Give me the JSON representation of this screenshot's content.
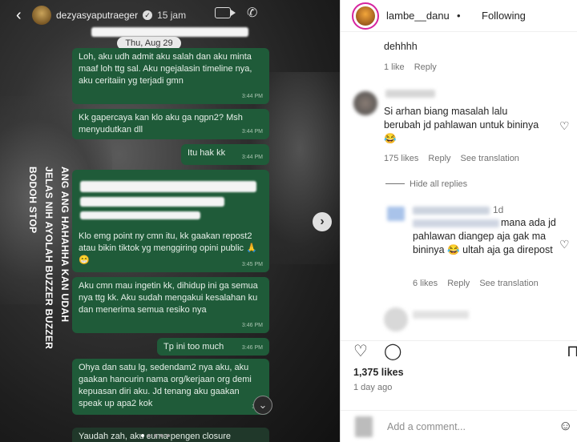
{
  "story": {
    "username": "dezyasyaputraeger",
    "time": "15 jam",
    "date": "Thu, Aug 29",
    "overlay_lines": [
      "ANG ANG HAHAHHA KAN UDAH",
      "JELAS NIH AYOLAH BUZZER BUZZER",
      "BODOH STOP"
    ],
    "messages": [
      {
        "text": "Loh, aku udh admit aku salah dan aku minta maaf loh ttg sal. Aku ngejalasin timeline nya, aku ceritaiin yg terjadi gmn",
        "time": "3:44 PM"
      },
      {
        "text": "Kk gapercaya kan klo aku ga ngpn2? Msh menyudutkan dll",
        "time": "3:44 PM"
      },
      {
        "text": "Itu hak kk",
        "time": "3:44 PM"
      },
      {
        "text": "Klo emg point ny cmn itu, kk gaakan repost2 atau bikin tiktok yg menggiring opini public 🙏😁",
        "time": "3:45 PM"
      },
      {
        "text": "Aku cmn mau ingetin kk, dihidup ini ga semua nya ttg kk. Aku sudah mengakui kesalahan ku dan menerima semua resiko nya",
        "time": "3:46 PM"
      },
      {
        "text": "Tp ini too much",
        "time": "3:46 PM"
      },
      {
        "text": "Ohya dan satu lg, sedendam2 nya aku, aku gaakan hancurin nama org/kerjaan org demi kepuasan diri aku. Jd tenang aku gaakan speak up apa2 kok",
        "time": "3:49"
      },
      {
        "text": "Yaudah zah, aku cuma pengen closure",
        "time": ""
      }
    ]
  },
  "post": {
    "username": "lambe__danu",
    "separator": "•",
    "follow_state": "Following",
    "likes": "1,375 likes",
    "posted": "1 day ago",
    "add_comment_placeholder": "Add a comment...",
    "hide_replies": "Hide all replies"
  },
  "comments": [
    {
      "text": "dehhhh",
      "likes": "1 like",
      "reply": "Reply"
    },
    {
      "text": "Si arhan biang masalah lalu berubah jd pahlawan untuk bininya 😂",
      "likes": "175 likes",
      "reply": "Reply",
      "translate": "See translation"
    },
    {
      "age": "1d",
      "text": "mana ada jd pahlawan diangep aja gak ma bininya 😂 ultah aja ga direpost",
      "likes": "6 likes",
      "reply": "Reply",
      "translate": "See translation"
    }
  ],
  "icons": [
    "back-chevron-icon",
    "verified-badge-icon",
    "video-call-icon",
    "voice-call-icon",
    "next-arrow-icon",
    "scroll-down-icon",
    "heart-icon",
    "comment-icon",
    "save-icon",
    "emoji-icon"
  ]
}
